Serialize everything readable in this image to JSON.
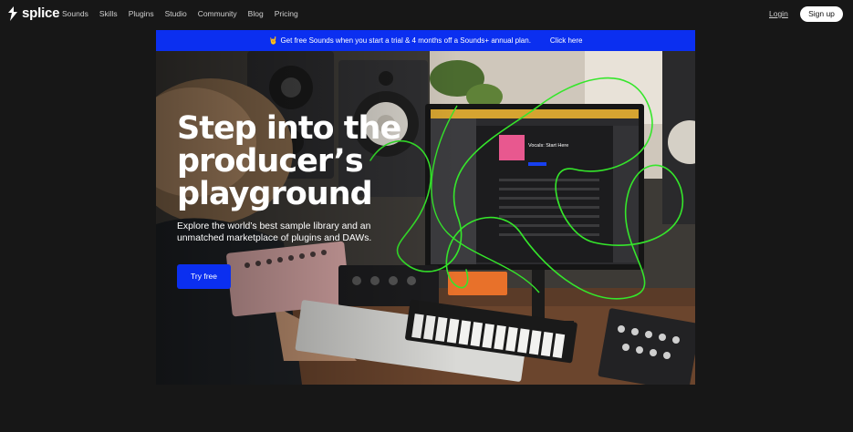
{
  "nav": {
    "logo_text": "splice",
    "links": [
      "Sounds",
      "Skills",
      "Plugins",
      "Studio",
      "Community",
      "Blog",
      "Pricing"
    ],
    "login": "Login",
    "signup": "Sign up"
  },
  "banner": {
    "emoji": "🤘",
    "text": "Get free Sounds when you start a trial & 4 months off a Sounds+ annual plan.",
    "cta": "Click here"
  },
  "hero": {
    "headline": [
      "Step into the",
      "producer’s",
      "playground"
    ],
    "subtext": "Explore the world’s best sample library and an unmatched marketplace of plugins and DAWs.",
    "cta": "Try free",
    "screen": {
      "album_label": "Vocals: Start Here"
    }
  },
  "colors": {
    "background": "#171717",
    "accent_blue": "#0b2ff0",
    "scribble_green": "#35e62b"
  }
}
